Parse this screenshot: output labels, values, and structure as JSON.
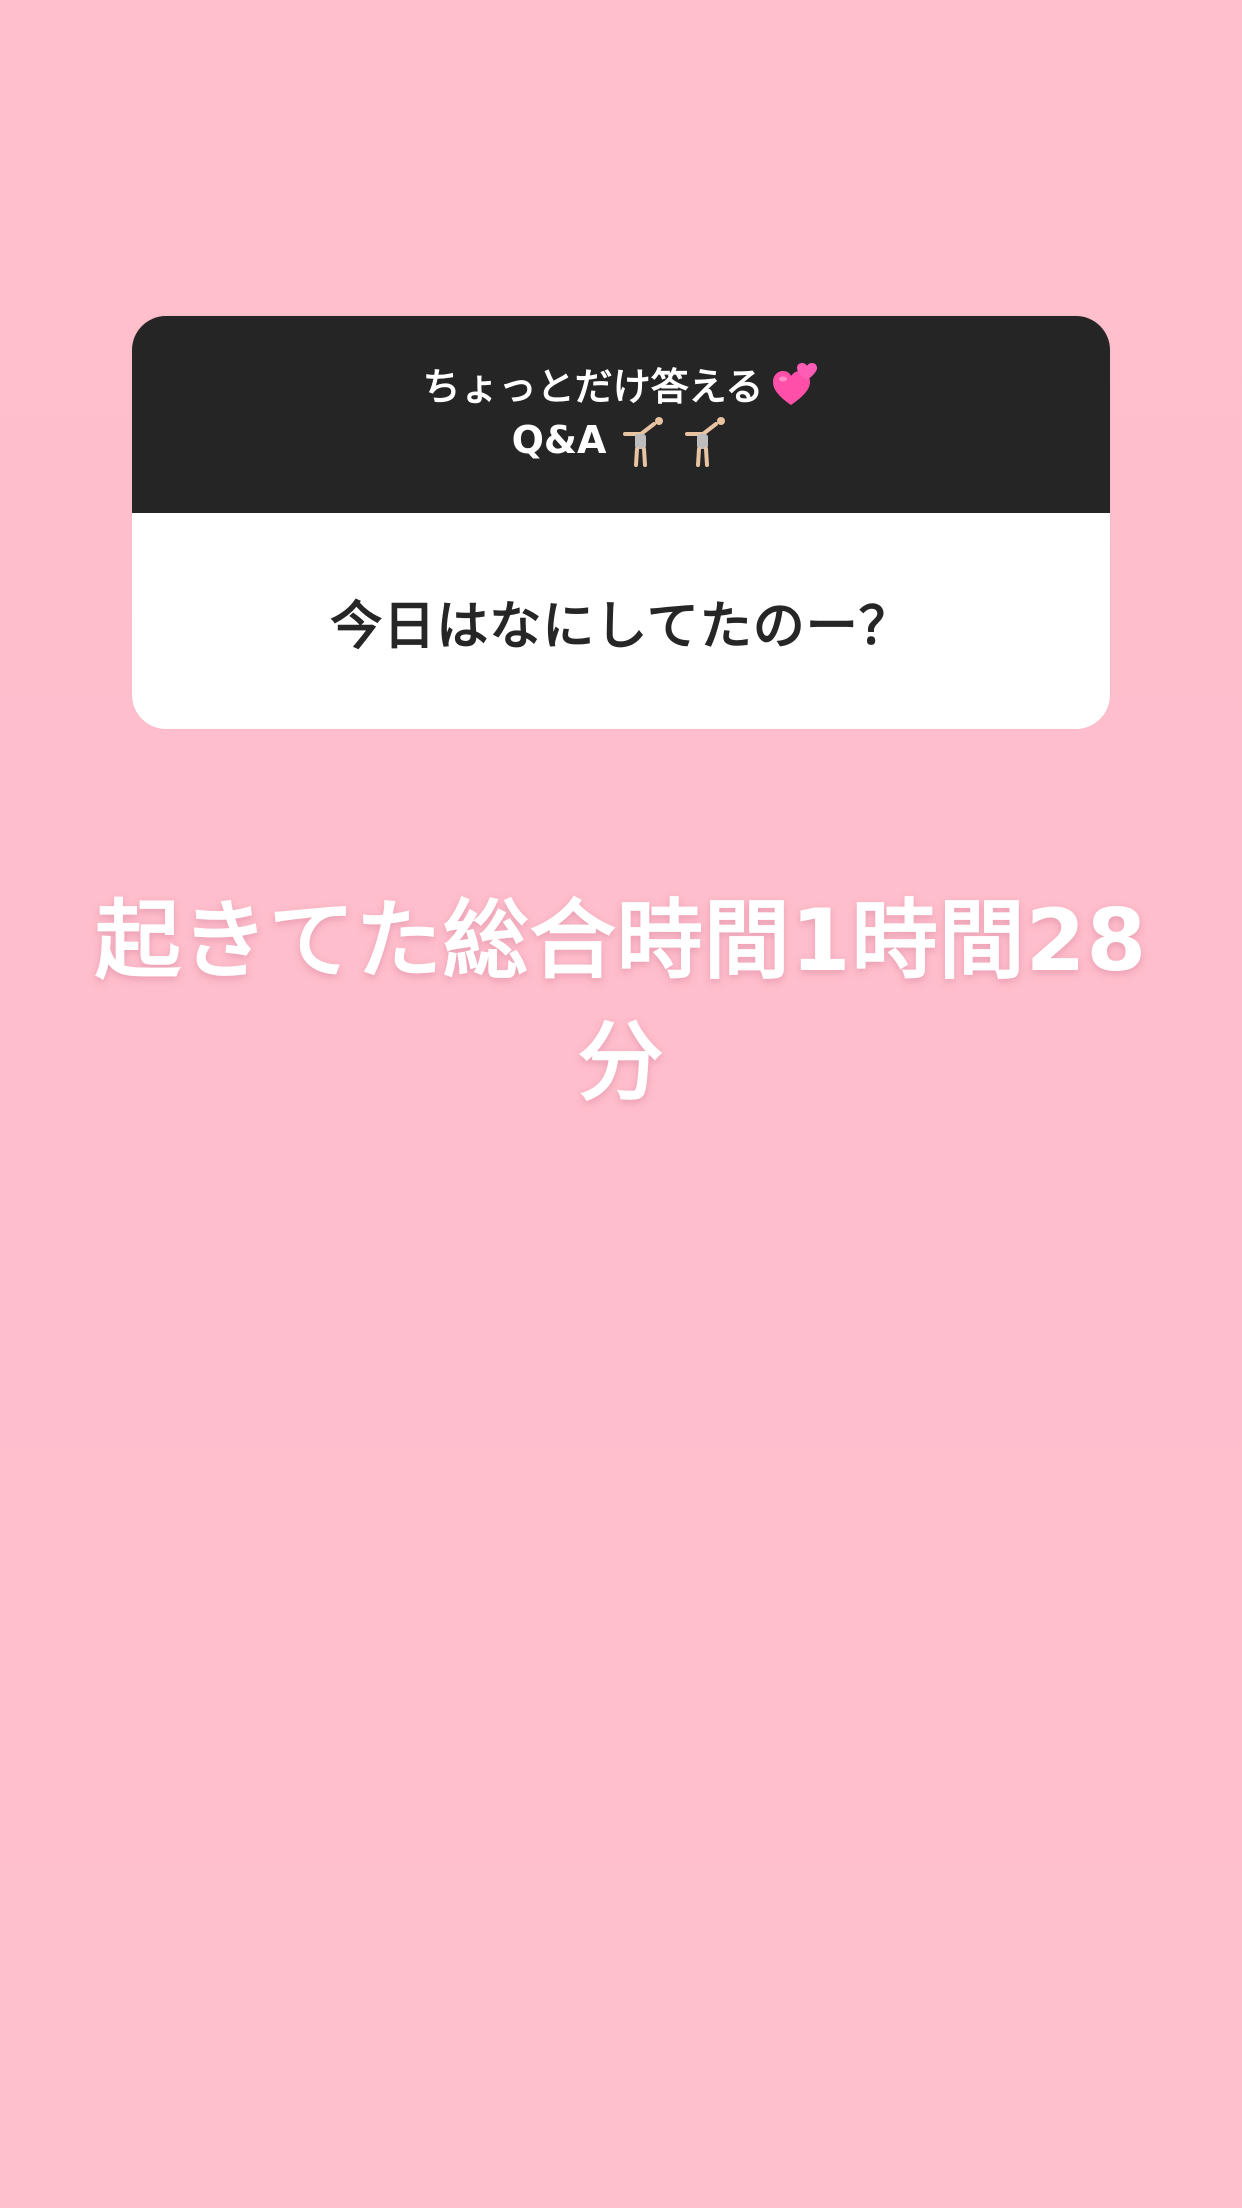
{
  "question_card": {
    "header_line1": "ちょっとだけ答える",
    "header_line2": "Q&A",
    "header_icons": [
      "two-hearts-icon",
      "person-cartwheeling-icon",
      "person-cartwheeling-icon"
    ],
    "question": "今日はなにしてたのー？"
  },
  "answer": {
    "text": "起きてた総合時間1時間28分"
  },
  "colors": {
    "background": "#ffbfcd",
    "card_header": "#252525",
    "card_body": "#ffffff",
    "heart": "#ff4fa8",
    "answer_text": "#ffffff"
  }
}
